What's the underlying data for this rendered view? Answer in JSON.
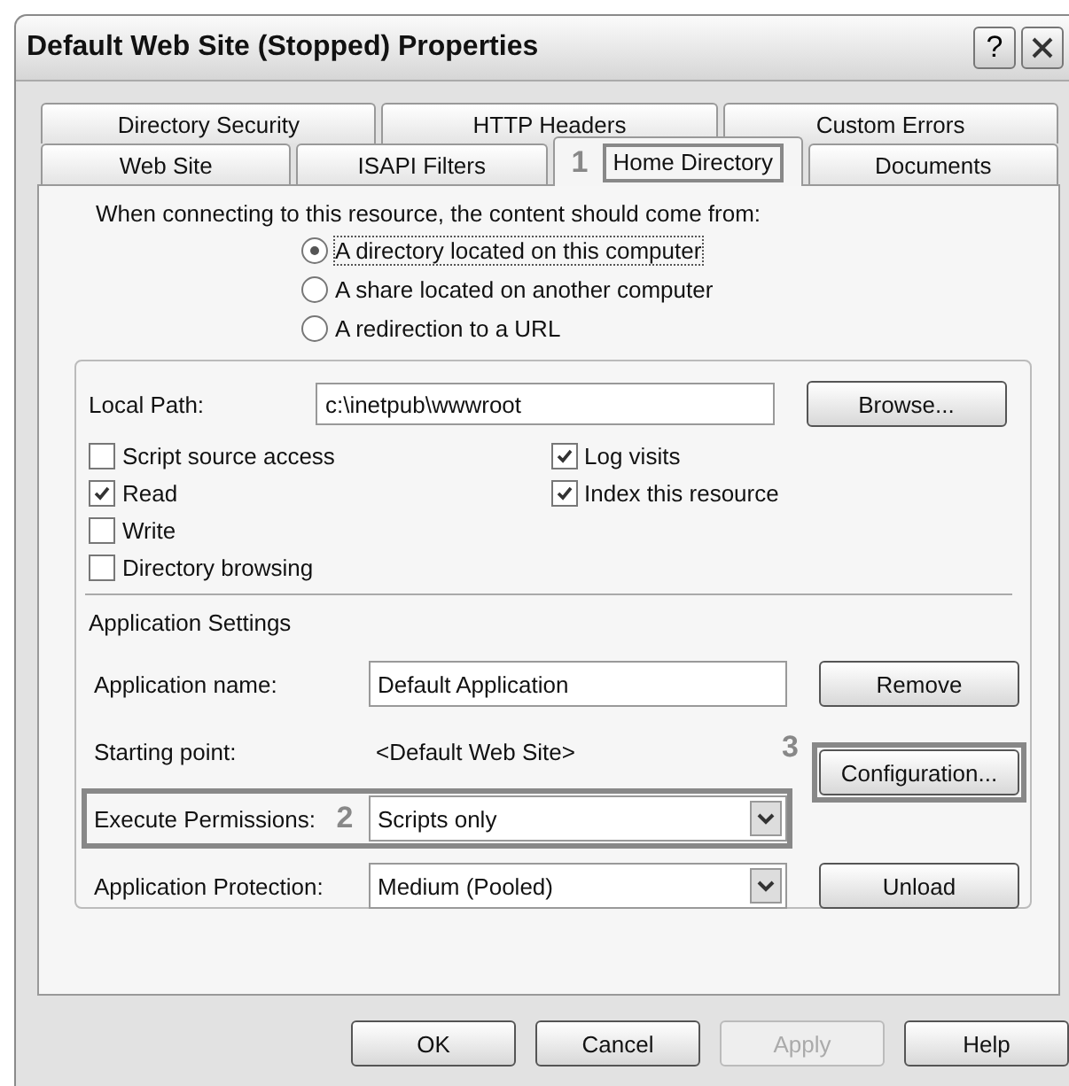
{
  "window": {
    "title": "Default Web Site (Stopped) Properties",
    "help_button": "?"
  },
  "tab_rows": [
    {
      "tabs": [
        {
          "label": "Directory Security",
          "selected": false,
          "highlighted": false
        },
        {
          "label": "HTTP Headers",
          "selected": false,
          "highlighted": false
        },
        {
          "label": "Custom Errors",
          "selected": false,
          "highlighted": false
        }
      ]
    },
    {
      "tabs": [
        {
          "label": "Web Site",
          "selected": false,
          "highlighted": false
        },
        {
          "label": "ISAPI Filters",
          "selected": false,
          "highlighted": false
        },
        {
          "label": "Home Directory",
          "selected": true,
          "highlighted": true,
          "callout": "1"
        },
        {
          "label": "Documents",
          "selected": false,
          "highlighted": false
        }
      ]
    }
  ],
  "source": {
    "prompt": "When connecting to this resource, the content should come from:",
    "options": [
      {
        "label": "A directory located on this computer",
        "selected": true
      },
      {
        "label": "A share located on another computer",
        "selected": false
      },
      {
        "label": "A redirection to a URL",
        "selected": false
      }
    ]
  },
  "local_path": {
    "label": "Local Path:",
    "value": "c:\\inetpub\\wwwroot",
    "button": "Browse..."
  },
  "permission_columns": [
    [
      {
        "label": "Script source access",
        "checked": false
      },
      {
        "label": "Read",
        "checked": true
      },
      {
        "label": "Write",
        "checked": false
      },
      {
        "label": "Directory browsing",
        "checked": false
      }
    ],
    [
      {
        "label": "Log visits",
        "checked": true
      },
      {
        "label": "Index this resource",
        "checked": true
      }
    ]
  ],
  "application_settings": {
    "heading": "Application Settings",
    "rows": [
      {
        "kind": "text",
        "label": "Application name:",
        "value": "Default Application",
        "highlighted": false,
        "button": {
          "label": "Remove",
          "highlighted": false
        }
      },
      {
        "kind": "static",
        "label": "Starting point:",
        "value": "<Default Web Site>",
        "highlighted": false,
        "button": {
          "label": "Configuration...",
          "highlighted": true,
          "callout": "3"
        }
      },
      {
        "kind": "select",
        "label": "Execute Permissions:",
        "value": "Scripts only",
        "highlighted": true,
        "callout": "2"
      },
      {
        "kind": "select",
        "label": "Application Protection:",
        "value": "Medium (Pooled)",
        "highlighted": false,
        "button": {
          "label": "Unload",
          "highlighted": false
        }
      }
    ]
  },
  "buttons": [
    {
      "label": "OK",
      "disabled": false
    },
    {
      "label": "Cancel",
      "disabled": false
    },
    {
      "label": "Apply",
      "disabled": true
    },
    {
      "label": "Help",
      "disabled": false
    }
  ]
}
